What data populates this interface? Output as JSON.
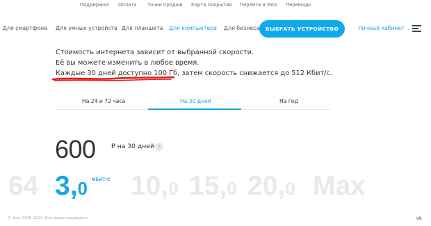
{
  "top_links": [
    "Поддержка",
    "Оплата",
    "Точки продаж",
    "Карта покрытия",
    "Перейти в Yota",
    "Переводы"
  ],
  "nav": {
    "items": [
      "Для смартфона",
      "Для умных устройств",
      "Для планшета",
      "Для компьютера",
      "Для бизнеса"
    ],
    "active_index": 3,
    "cta_label": "ВЫБРАТЬ УСТРОЙСТВО",
    "account_label": "Личный кабинет"
  },
  "description": {
    "line1": "Стоимость интернета зависит от выбранной скорости.",
    "line2": "Её вы можете изменить в любое время.",
    "line3": "Каждые 30 дней доступно 100 Гб, затем скорость снижается до 512 Кбит/с."
  },
  "tabs": {
    "items": [
      "На 24 и 72 часа",
      "На 30 дней",
      "На год"
    ],
    "active_index": 1
  },
  "price": {
    "amount": "600",
    "unit": "₽ на 30 дней",
    "help": "?"
  },
  "speeds": {
    "items": [
      {
        "int": "64",
        "dec": ""
      },
      {
        "int": "3,",
        "dec": "0"
      },
      {
        "int": "10,",
        "dec": "0"
      },
      {
        "int": "15,",
        "dec": "0"
      },
      {
        "int": "20,",
        "dec": "0"
      },
      {
        "int": "Max",
        "dec": ""
      }
    ],
    "active_index": 1,
    "unit": "МБИТ/С"
  },
  "footer": {
    "copyright": "© Yota 2008–2024. Все права защищены.",
    "social_icon": "vk-icon",
    "social_label": "vk"
  },
  "colors": {
    "accent": "#1aa6e8",
    "button": "#12a9ec",
    "underline_annotation": "#e0201b",
    "inactive_speed": "#e7e9ec"
  }
}
